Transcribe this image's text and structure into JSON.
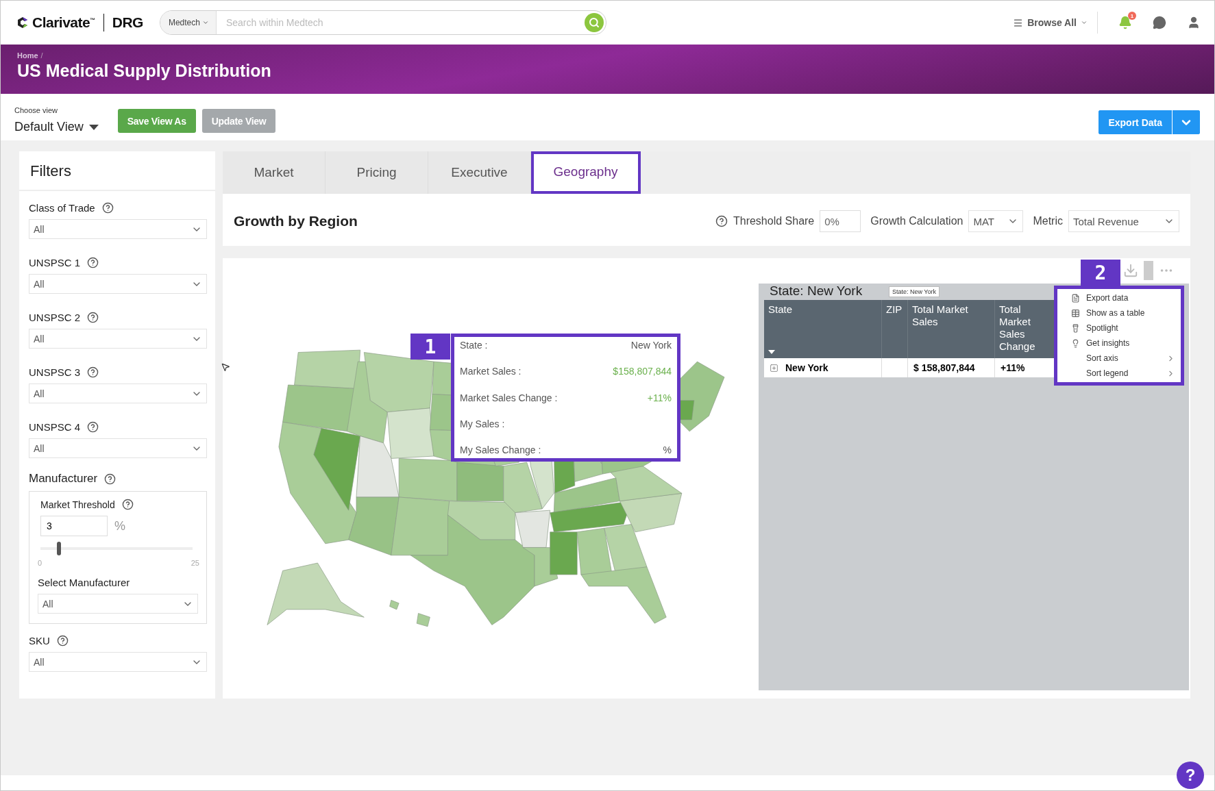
{
  "header": {
    "logo": "Clarivate",
    "logo_tm": "™",
    "brand": "DRG",
    "search_scope": "Medtech",
    "search_placeholder": "Search within Medtech",
    "browse": "Browse All",
    "notification_count": "1"
  },
  "banner": {
    "breadcrumb": "Home",
    "breadcrumb_sep": "/",
    "title": "US Medical Supply Distribution"
  },
  "view_bar": {
    "label": "Choose view",
    "view": "Default View",
    "save": "Save View As",
    "update": "Update View",
    "export": "Export Data"
  },
  "filters": {
    "title": "Filters",
    "items": [
      {
        "label": "Class of Trade",
        "value": "All"
      },
      {
        "label": "UNSPSC 1",
        "value": "All"
      },
      {
        "label": "UNSPSC 2",
        "value": "All"
      },
      {
        "label": "UNSPSC 3",
        "value": "All"
      },
      {
        "label": "UNSPSC 4",
        "value": "All"
      }
    ],
    "manufacturer": {
      "label": "Manufacturer",
      "threshold_label": "Market Threshold",
      "threshold_value": "3",
      "unit": "%",
      "level": 0.12,
      "min": "0",
      "max": "25",
      "select_label": "Select Manufacturer",
      "select_value": "All"
    },
    "sku": {
      "label": "SKU",
      "value": "All"
    }
  },
  "tabs": [
    {
      "label": "Market",
      "selected": false
    },
    {
      "label": "Pricing",
      "selected": false
    },
    {
      "label": "Executive",
      "selected": false
    },
    {
      "label": "Geography",
      "selected": true
    }
  ],
  "report": {
    "title": "Growth by Region",
    "threshold_label": "Threshold Share",
    "threshold_value": "0%",
    "growth_label": "Growth Calculation",
    "growth_value": "MAT",
    "metric_label": "Metric",
    "metric_value": "Total Revenue"
  },
  "callouts": [
    "1",
    "2"
  ],
  "tooltip": [
    {
      "label": "State :",
      "value": "New York",
      "positive": false
    },
    {
      "label": "Market Sales :",
      "value": "$158,807,844",
      "positive": true
    },
    {
      "label": "Market Sales Change :",
      "value": "+11%",
      "positive": true
    },
    {
      "label": "My Sales :"
    },
    {
      "label": "My Sales Change :",
      "value": "%",
      "positive": false
    }
  ],
  "table": {
    "title": "State: New York",
    "title_tip": "State: New York",
    "columns": [
      "State",
      "ZIP",
      "Total Market Sales",
      "Total Market Sales Change"
    ],
    "rows": [
      {
        "state": "New York",
        "total_market_sales": "$ 158,807,844",
        "change": "+11%"
      }
    ]
  },
  "context_menu": [
    {
      "label": "Export data",
      "kind": "action"
    },
    {
      "label": "Show as a table",
      "kind": "action"
    },
    {
      "label": "Spotlight",
      "kind": "action"
    },
    {
      "label": "Get insights",
      "kind": "action"
    },
    {
      "label": "Sort axis",
      "kind": "submenu"
    },
    {
      "label": "Sort legend",
      "kind": "submenu"
    }
  ],
  "help": "?"
}
